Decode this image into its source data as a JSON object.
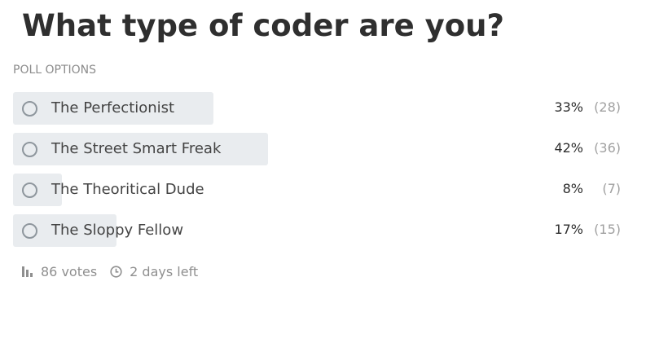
{
  "poll": {
    "title": "What type of coder are you?",
    "section_label": "POLL OPTIONS",
    "options": [
      {
        "label": "The Perfectionist",
        "percent_text": "33%",
        "count_text": "(28)",
        "share": 0.33
      },
      {
        "label": "The Street Smart Freak",
        "percent_text": "42%",
        "count_text": "(36)",
        "share": 0.42
      },
      {
        "label": "The Theoritical Dude",
        "percent_text": "8%",
        "count_text": "(7)",
        "share": 0.08
      },
      {
        "label": "The Sloppy Fellow",
        "percent_text": "17%",
        "count_text": "(15)",
        "share": 0.17
      }
    ],
    "footer": {
      "votes": "86 votes",
      "time_left": "2 days left",
      "votes_icon": "bar-chart-icon",
      "time_icon": "clock-icon"
    },
    "colors": {
      "bar": "#e9ecef",
      "radio": "#8e969d",
      "muted": "#8f8f8f"
    }
  }
}
